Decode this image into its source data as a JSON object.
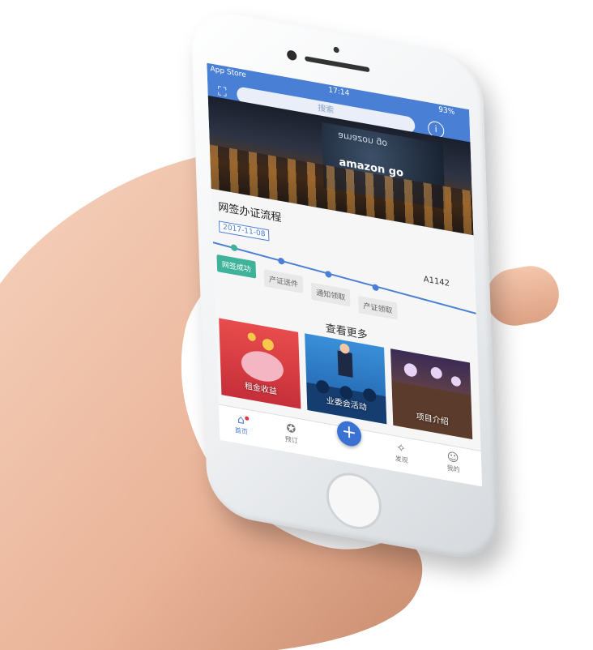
{
  "status_bar": {
    "carrier": "App Store",
    "time": "17:14",
    "battery": "93%"
  },
  "header": {
    "search_placeholder": "搜索",
    "scan_icon": "scan-icon",
    "info_icon": "info-icon"
  },
  "banner": {
    "sign_text": "amazon go",
    "sign_mirror": "amazon go"
  },
  "process": {
    "title": "网签办证流程",
    "date": "2017-11-08",
    "doc_number": "A1142",
    "steps": [
      {
        "label": "网签成功",
        "done": true
      },
      {
        "label": "产证送件",
        "done": false
      },
      {
        "label": "通知领取",
        "done": false
      },
      {
        "label": "产证领取",
        "done": false
      }
    ]
  },
  "more": {
    "title": "查看更多",
    "cards": [
      {
        "label": "租金收益"
      },
      {
        "label": "业委会活动"
      },
      {
        "label": "项目介绍"
      }
    ]
  },
  "tabbar": {
    "items": [
      {
        "label": "首页",
        "icon": "home-icon"
      },
      {
        "label": "预订",
        "icon": "award-icon"
      },
      {
        "label": "",
        "icon": "plus-icon"
      },
      {
        "label": "发现",
        "icon": "compass-icon"
      },
      {
        "label": "我的",
        "icon": "user-icon"
      }
    ]
  },
  "colors": {
    "accent": "#4a7fd6",
    "done": "#3fb39a"
  }
}
